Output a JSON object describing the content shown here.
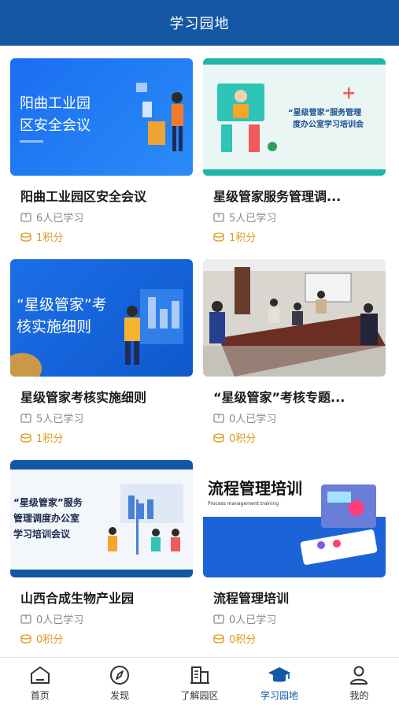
{
  "header": {
    "title": "学习园地"
  },
  "cards": [
    {
      "title": "阳曲工业园区安全会议",
      "learners": "6人已学习",
      "points": "1积分",
      "thumb_text": [
        "阳曲工业园",
        "区安全会议"
      ]
    },
    {
      "title": "星级管家服务管理调...",
      "learners": "5人已学习",
      "points": "1积分",
      "thumb_text": [
        "“星级管家”服务管理",
        "度办公室学习培训会"
      ]
    },
    {
      "title": "星级管家考核实施细则",
      "learners": "5人已学习",
      "points": "1积分",
      "thumb_text": [
        "“星级管家”考",
        "核实施细则"
      ]
    },
    {
      "title": "“星级管家”考核专题...",
      "learners": "0人已学习",
      "points": "0积分"
    },
    {
      "title": "山西合成生物产业园",
      "learners": "0人已学习",
      "points": "0积分",
      "thumb_text": [
        "“星级管家”服务",
        "管理调度办公室",
        "学习培训会议"
      ]
    },
    {
      "title": "流程管理培训",
      "learners": "0人已学习",
      "points": "0积分",
      "thumb_text": [
        "流程管理培训",
        "Process management training"
      ]
    }
  ],
  "tabbar": [
    {
      "label": "首页",
      "icon": "home-icon"
    },
    {
      "label": "发现",
      "icon": "compass-icon"
    },
    {
      "label": "了解园区",
      "icon": "building-icon"
    },
    {
      "label": "学习园地",
      "icon": "graduation-cap-icon",
      "active": true
    },
    {
      "label": "我的",
      "icon": "user-icon"
    }
  ],
  "colors": {
    "primary": "#1457a5",
    "points": "#d99a1c",
    "muted": "#8a8a8a"
  }
}
